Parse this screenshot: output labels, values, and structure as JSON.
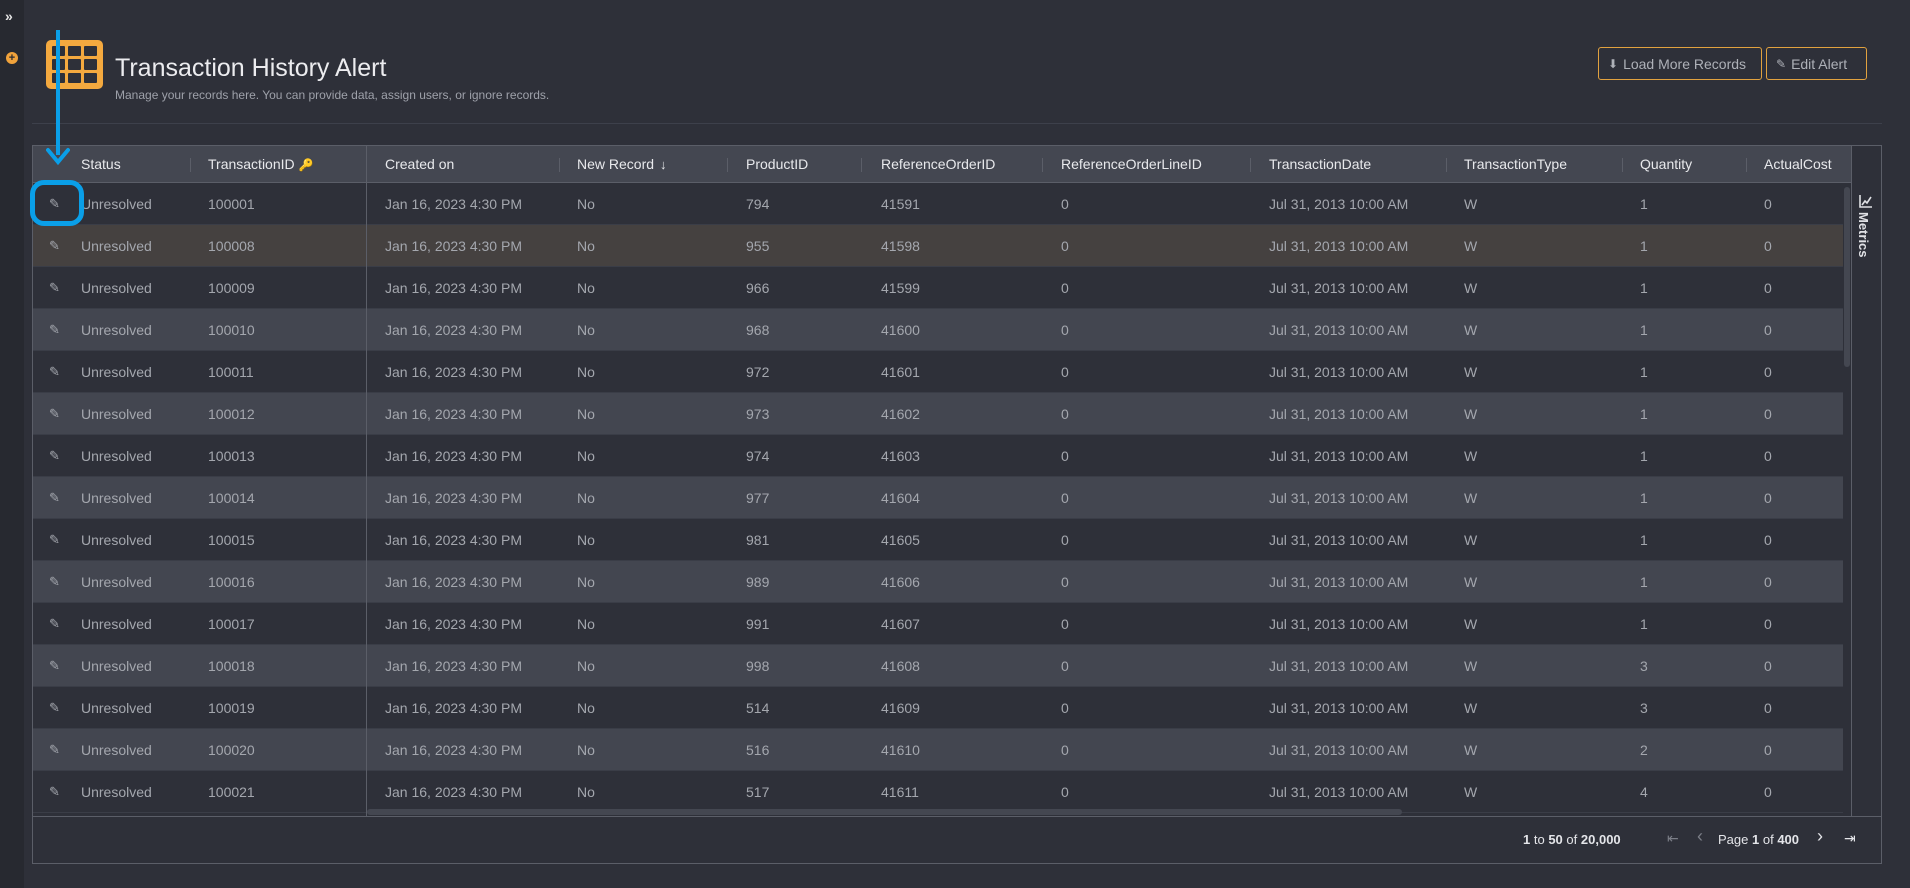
{
  "sidebar": {
    "expand_icon": "»",
    "add_icon": "+"
  },
  "header": {
    "icon": "table-grid-icon",
    "title": "Transaction History Alert",
    "subtitle": "Manage your records here. You can provide data, assign users, or ignore records."
  },
  "toolbar": {
    "load_more_icon": "⬇",
    "load_more_label": "Load More Records",
    "edit_alert_icon": "✎",
    "edit_alert_label": "Edit Alert"
  },
  "colors": {
    "accent": "#f0a23b",
    "background": "#2e3039",
    "header_row": "#444751",
    "annotation": "#0a9fe8"
  },
  "table": {
    "columns": [
      {
        "label": "Status"
      },
      {
        "label": "TransactionID",
        "icon": "key-icon"
      },
      {
        "label": "Created on"
      },
      {
        "label": "New Record",
        "sort": "descending"
      },
      {
        "label": "ProductID"
      },
      {
        "label": "ReferenceOrderID"
      },
      {
        "label": "ReferenceOrderLineID"
      },
      {
        "label": "TransactionDate"
      },
      {
        "label": "TransactionType"
      },
      {
        "label": "Quantity"
      },
      {
        "label": "ActualCost"
      }
    ],
    "key_icon": "🔑",
    "sort_icon": "↓",
    "edit_icon": "✎",
    "rows": [
      {
        "status": "Unresolved",
        "transaction_id": "100001",
        "created_on": "Jan 16, 2023 4:30 PM",
        "new_record": "No",
        "product_id": "794",
        "reference_order_id": "41591",
        "reference_order_line_id": "0",
        "transaction_date": "Jul 31, 2013 10:00 AM",
        "transaction_type": "W",
        "quantity": "1",
        "actual_cost": "0"
      },
      {
        "status": "Unresolved",
        "transaction_id": "100008",
        "created_on": "Jan 16, 2023 4:30 PM",
        "new_record": "No",
        "product_id": "955",
        "reference_order_id": "41598",
        "reference_order_line_id": "0",
        "transaction_date": "Jul 31, 2013 10:00 AM",
        "transaction_type": "W",
        "quantity": "1",
        "actual_cost": "0"
      },
      {
        "status": "Unresolved",
        "transaction_id": "100009",
        "created_on": "Jan 16, 2023 4:30 PM",
        "new_record": "No",
        "product_id": "966",
        "reference_order_id": "41599",
        "reference_order_line_id": "0",
        "transaction_date": "Jul 31, 2013 10:00 AM",
        "transaction_type": "W",
        "quantity": "1",
        "actual_cost": "0"
      },
      {
        "status": "Unresolved",
        "transaction_id": "100010",
        "created_on": "Jan 16, 2023 4:30 PM",
        "new_record": "No",
        "product_id": "968",
        "reference_order_id": "41600",
        "reference_order_line_id": "0",
        "transaction_date": "Jul 31, 2013 10:00 AM",
        "transaction_type": "W",
        "quantity": "1",
        "actual_cost": "0"
      },
      {
        "status": "Unresolved",
        "transaction_id": "100011",
        "created_on": "Jan 16, 2023 4:30 PM",
        "new_record": "No",
        "product_id": "972",
        "reference_order_id": "41601",
        "reference_order_line_id": "0",
        "transaction_date": "Jul 31, 2013 10:00 AM",
        "transaction_type": "W",
        "quantity": "1",
        "actual_cost": "0"
      },
      {
        "status": "Unresolved",
        "transaction_id": "100012",
        "created_on": "Jan 16, 2023 4:30 PM",
        "new_record": "No",
        "product_id": "973",
        "reference_order_id": "41602",
        "reference_order_line_id": "0",
        "transaction_date": "Jul 31, 2013 10:00 AM",
        "transaction_type": "W",
        "quantity": "1",
        "actual_cost": "0"
      },
      {
        "status": "Unresolved",
        "transaction_id": "100013",
        "created_on": "Jan 16, 2023 4:30 PM",
        "new_record": "No",
        "product_id": "974",
        "reference_order_id": "41603",
        "reference_order_line_id": "0",
        "transaction_date": "Jul 31, 2013 10:00 AM",
        "transaction_type": "W",
        "quantity": "1",
        "actual_cost": "0"
      },
      {
        "status": "Unresolved",
        "transaction_id": "100014",
        "created_on": "Jan 16, 2023 4:30 PM",
        "new_record": "No",
        "product_id": "977",
        "reference_order_id": "41604",
        "reference_order_line_id": "0",
        "transaction_date": "Jul 31, 2013 10:00 AM",
        "transaction_type": "W",
        "quantity": "1",
        "actual_cost": "0"
      },
      {
        "status": "Unresolved",
        "transaction_id": "100015",
        "created_on": "Jan 16, 2023 4:30 PM",
        "new_record": "No",
        "product_id": "981",
        "reference_order_id": "41605",
        "reference_order_line_id": "0",
        "transaction_date": "Jul 31, 2013 10:00 AM",
        "transaction_type": "W",
        "quantity": "1",
        "actual_cost": "0"
      },
      {
        "status": "Unresolved",
        "transaction_id": "100016",
        "created_on": "Jan 16, 2023 4:30 PM",
        "new_record": "No",
        "product_id": "989",
        "reference_order_id": "41606",
        "reference_order_line_id": "0",
        "transaction_date": "Jul 31, 2013 10:00 AM",
        "transaction_type": "W",
        "quantity": "1",
        "actual_cost": "0"
      },
      {
        "status": "Unresolved",
        "transaction_id": "100017",
        "created_on": "Jan 16, 2023 4:30 PM",
        "new_record": "No",
        "product_id": "991",
        "reference_order_id": "41607",
        "reference_order_line_id": "0",
        "transaction_date": "Jul 31, 2013 10:00 AM",
        "transaction_type": "W",
        "quantity": "1",
        "actual_cost": "0"
      },
      {
        "status": "Unresolved",
        "transaction_id": "100018",
        "created_on": "Jan 16, 2023 4:30 PM",
        "new_record": "No",
        "product_id": "998",
        "reference_order_id": "41608",
        "reference_order_line_id": "0",
        "transaction_date": "Jul 31, 2013 10:00 AM",
        "transaction_type": "W",
        "quantity": "3",
        "actual_cost": "0"
      },
      {
        "status": "Unresolved",
        "transaction_id": "100019",
        "created_on": "Jan 16, 2023 4:30 PM",
        "new_record": "No",
        "product_id": "514",
        "reference_order_id": "41609",
        "reference_order_line_id": "0",
        "transaction_date": "Jul 31, 2013 10:00 AM",
        "transaction_type": "W",
        "quantity": "3",
        "actual_cost": "0"
      },
      {
        "status": "Unresolved",
        "transaction_id": "100020",
        "created_on": "Jan 16, 2023 4:30 PM",
        "new_record": "No",
        "product_id": "516",
        "reference_order_id": "41610",
        "reference_order_line_id": "0",
        "transaction_date": "Jul 31, 2013 10:00 AM",
        "transaction_type": "W",
        "quantity": "2",
        "actual_cost": "0"
      },
      {
        "status": "Unresolved",
        "transaction_id": "100021",
        "created_on": "Jan 16, 2023 4:30 PM",
        "new_record": "No",
        "product_id": "517",
        "reference_order_id": "41611",
        "reference_order_line_id": "0",
        "transaction_date": "Jul 31, 2013 10:00 AM",
        "transaction_type": "W",
        "quantity": "4",
        "actual_cost": "0"
      }
    ],
    "hovered_row": 1
  },
  "metrics_panel": {
    "icon": "chart-line-icon",
    "label": "Metrics"
  },
  "pagination": {
    "range_start": "1",
    "range_to": "to",
    "range_end": "50",
    "range_of": "of",
    "total": "20,000",
    "page_label": "Page",
    "current_page": "1",
    "page_of": "of",
    "total_pages": "400",
    "first_icon": "⇤",
    "prev_icon": "‹",
    "next_icon": "›",
    "last_icon": "⇥"
  }
}
